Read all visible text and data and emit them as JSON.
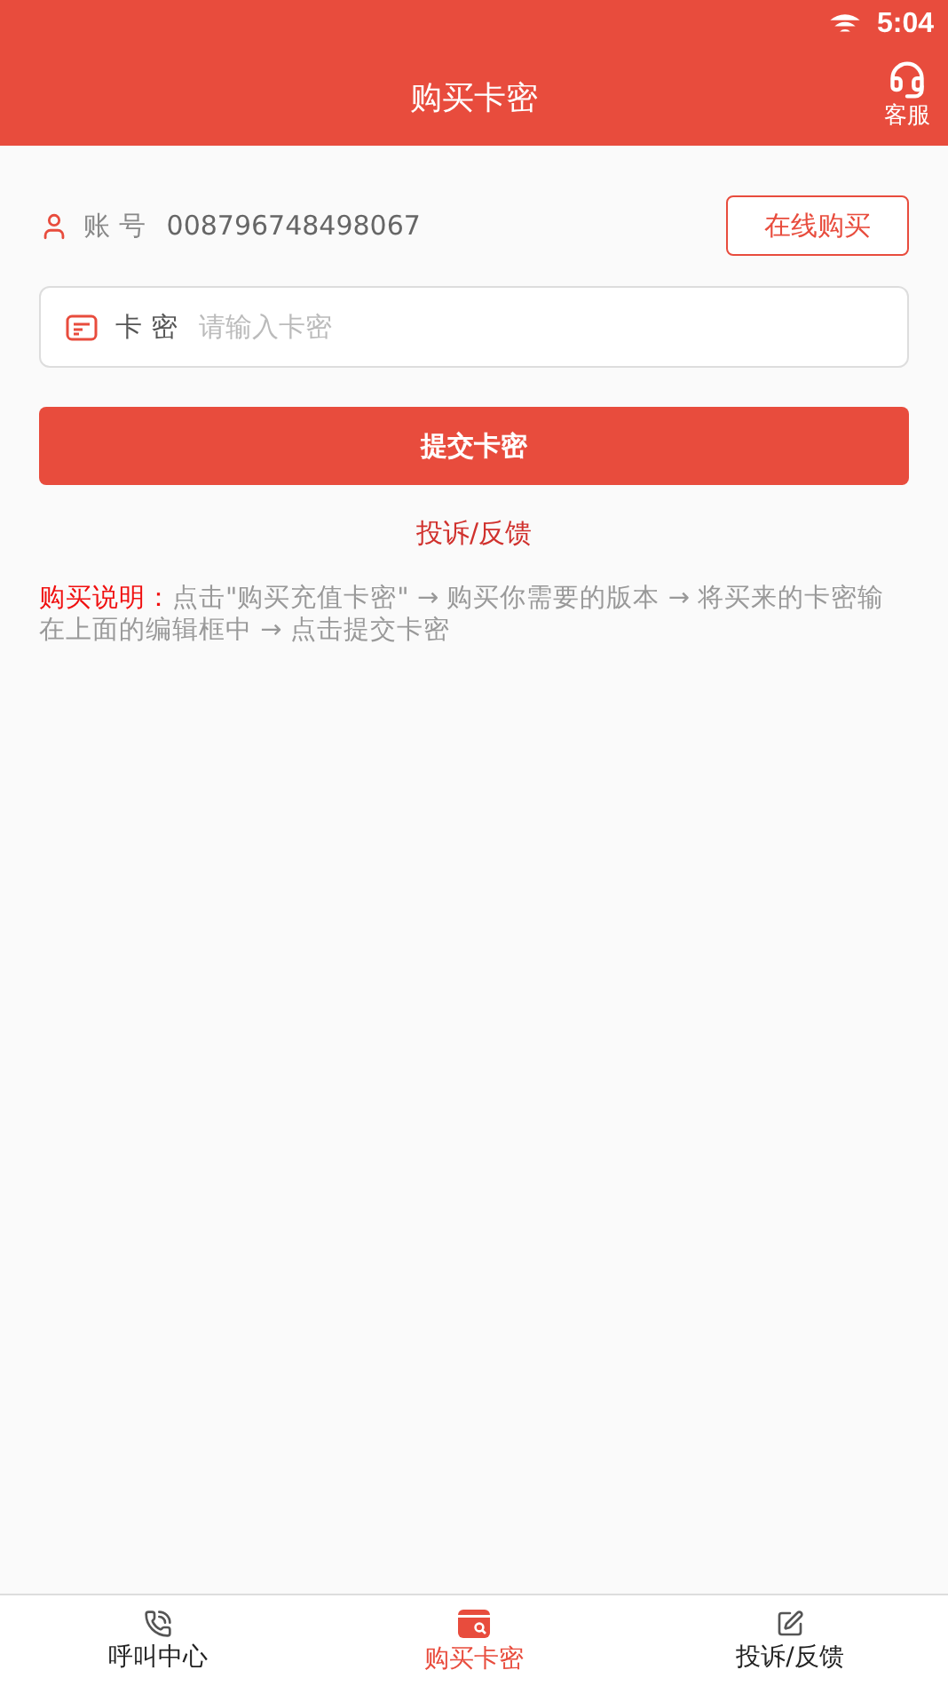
{
  "status_bar": {
    "time": "5:04"
  },
  "header": {
    "title": "购买卡密",
    "action": {
      "label": "客服"
    }
  },
  "account": {
    "label": "账 号",
    "value": "008796748498067",
    "button": "在线购买"
  },
  "card_field": {
    "label": "卡 密",
    "placeholder": "请输入卡密"
  },
  "submit_button": "提交卡密",
  "complaint_link": "投诉/反馈",
  "instructions": {
    "label": "购买说明：",
    "text": "点击\"购买充值卡密\" → 购买你需要的版本 → 将买来的卡密输在上面的编辑框中 → 点击提交卡密"
  },
  "bottom_nav": [
    {
      "kind": "phone",
      "label": "呼叫中心",
      "selected": false
    },
    {
      "kind": "card",
      "label": "购买卡密",
      "selected": true
    },
    {
      "kind": "edit",
      "label": "投诉/反馈",
      "selected": false
    }
  ]
}
